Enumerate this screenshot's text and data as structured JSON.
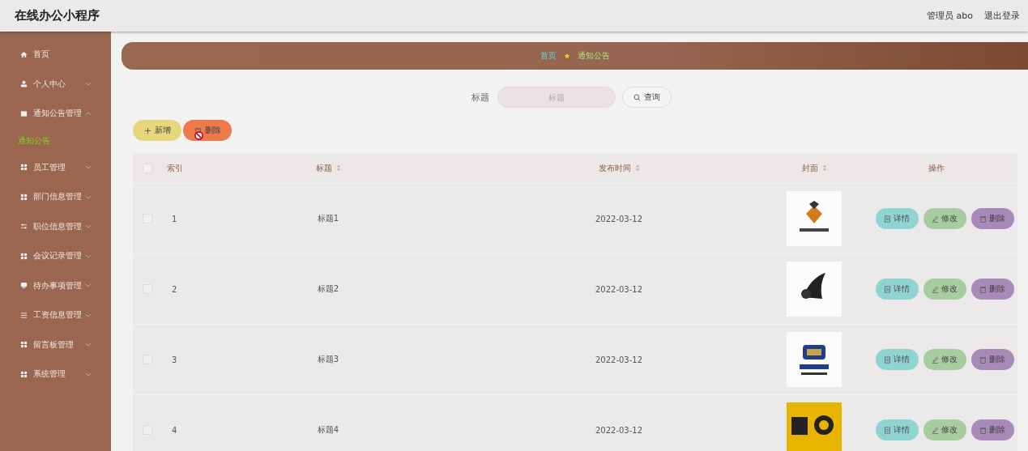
{
  "header": {
    "title": "在线办公小程序",
    "user": "管理员 abo",
    "logout": "退出登录"
  },
  "sidebar": {
    "items": [
      {
        "label": "首页",
        "kind": "home",
        "expandable": false
      },
      {
        "label": "个人中心",
        "kind": "user",
        "expandable": true,
        "expanded": false
      },
      {
        "label": "通知公告管理",
        "kind": "doc",
        "expandable": true,
        "expanded": true,
        "children": [
          {
            "label": "通知公告",
            "selected": true
          }
        ]
      },
      {
        "label": "员工管理",
        "kind": "grid",
        "expandable": true,
        "expanded": false
      },
      {
        "label": "部门信息管理",
        "kind": "grid",
        "expandable": true,
        "expanded": false
      },
      {
        "label": "职位信息管理",
        "kind": "sliders",
        "expandable": true,
        "expanded": false
      },
      {
        "label": "会议记录管理",
        "kind": "grid",
        "expandable": true,
        "expanded": false
      },
      {
        "label": "待办事项管理",
        "kind": "chat",
        "expandable": true,
        "expanded": false
      },
      {
        "label": "工资信息管理",
        "kind": "list",
        "expandable": true,
        "expanded": false
      },
      {
        "label": "留言板管理",
        "kind": "grid",
        "expandable": true,
        "expanded": false
      },
      {
        "label": "系统管理",
        "kind": "grid",
        "expandable": true,
        "expanded": false
      }
    ]
  },
  "breadcrumb": [
    "首页",
    "通知公告"
  ],
  "search": {
    "label": "标题",
    "placeholder": "标题",
    "button": "查询"
  },
  "toolbar": [
    {
      "label": "新增",
      "kind": "add"
    },
    {
      "label": "删除",
      "kind": "delete"
    }
  ],
  "table": {
    "all_selected": false,
    "columns": [
      {
        "label": "索引",
        "sortable": false
      },
      {
        "label": "标题",
        "sortable": true
      },
      {
        "label": "发布时间",
        "sortable": true
      },
      {
        "label": "封面",
        "sortable": true
      },
      {
        "label": "操作",
        "sortable": false
      }
    ],
    "rows": [
      {
        "selected": false,
        "index": "1",
        "title": "标题1",
        "date": "2022-03-12",
        "cover": {
          "kind": "picture"
        },
        "actions": [
          {
            "label": "详情",
            "kind": "detail"
          },
          {
            "label": "修改",
            "kind": "edit"
          },
          {
            "label": "删除",
            "kind": "delete"
          }
        ]
      },
      {
        "selected": false,
        "index": "2",
        "title": "标题2",
        "date": "2022-03-12",
        "cover": {
          "kind": "picture"
        },
        "actions": [
          {
            "label": "详情",
            "kind": "detail"
          },
          {
            "label": "修改",
            "kind": "edit"
          },
          {
            "label": "删除",
            "kind": "delete"
          }
        ]
      },
      {
        "selected": false,
        "index": "3",
        "title": "标题3",
        "date": "2022-03-12",
        "cover": {
          "kind": "picture"
        },
        "actions": [
          {
            "label": "详情",
            "kind": "detail"
          },
          {
            "label": "修改",
            "kind": "edit"
          },
          {
            "label": "删除",
            "kind": "delete"
          }
        ]
      },
      {
        "selected": false,
        "index": "4",
        "title": "标题4",
        "date": "2022-03-12",
        "cover": {
          "kind": "picture"
        },
        "actions": [
          {
            "label": "详情",
            "kind": "detail"
          },
          {
            "label": "修改",
            "kind": "edit"
          },
          {
            "label": "删除",
            "kind": "delete"
          }
        ]
      }
    ]
  }
}
